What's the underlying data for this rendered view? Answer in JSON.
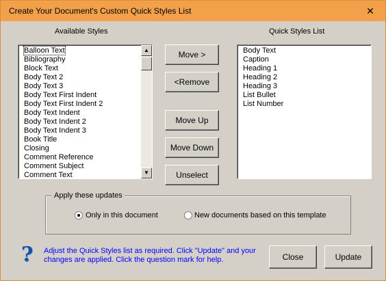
{
  "window": {
    "title": "Create Your Document's Custom Quick Styles List",
    "close_glyph": "✕"
  },
  "available": {
    "label": "Available Styles",
    "items": [
      "Balloon Text",
      "Bibliography",
      "Block Text",
      "Body Text 2",
      "Body Text 3",
      "Body Text First Indent",
      "Body Text First Indent 2",
      "Body Text Indent",
      "Body Text Indent 2",
      "Body Text Indent 3",
      "Book Title",
      "Closing",
      "Comment Reference",
      "Comment Subject",
      "Comment Text"
    ]
  },
  "quick": {
    "label": "Quick Styles List",
    "items": [
      "Body Text",
      "Caption",
      "Heading 1",
      "Heading 2",
      "Heading 3",
      "List Bullet",
      "List Number"
    ]
  },
  "buttons": {
    "move": "Move >",
    "remove": "<Remove",
    "move_up": "Move Up",
    "move_down": "Move Down",
    "unselect": "Unselect",
    "close": "Close",
    "update": "Update"
  },
  "apply": {
    "legend": "Apply these updates",
    "option_1": "Only in this document",
    "option_2": "New documents based on this template",
    "selected": "option_1"
  },
  "help": {
    "icon": "?",
    "text_line1": "Adjust the Quick Styles list as required. Click \"Update\" and your",
    "text_line2": "changes are applied. Click the question mark for help."
  }
}
